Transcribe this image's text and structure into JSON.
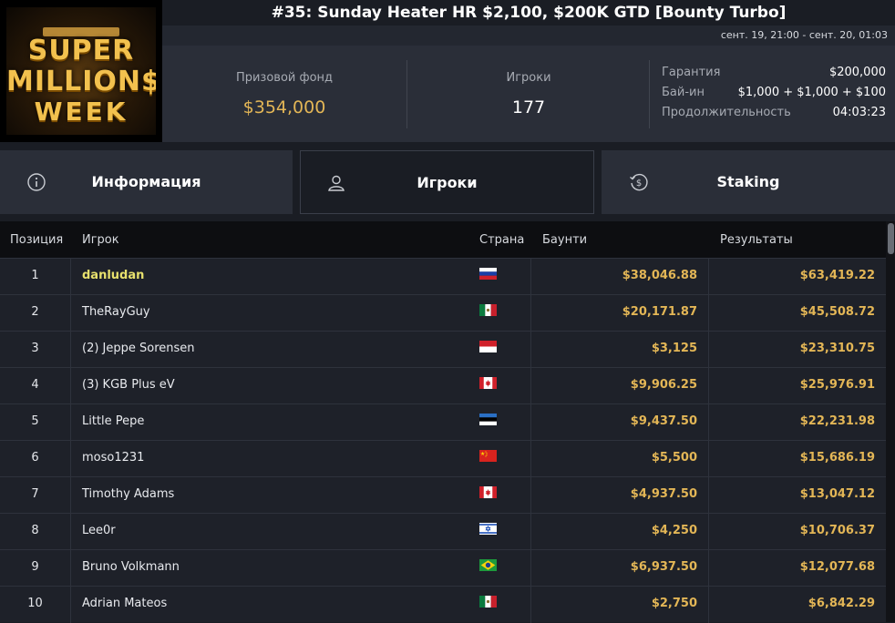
{
  "logo": {
    "line1": "SUPER",
    "line2": "MILLION$",
    "line3": "WEEK"
  },
  "header": {
    "title": "#35: Sunday Heater HR $2,100, $200K GTD [Bounty Turbo]",
    "dates": "сент. 19, 21:00 - сент. 20, 01:03"
  },
  "stats": {
    "prize_label": "Призовой фонд",
    "prize_value": "$354,000",
    "players_label": "Игроки",
    "players_value": "177",
    "details": [
      {
        "label": "Гарантия",
        "value": "$200,000"
      },
      {
        "label": "Бай-ин",
        "value": "$1,000 + $1,000 + $100"
      },
      {
        "label": "Продолжительность",
        "value": "04:03:23"
      }
    ]
  },
  "tabs": [
    {
      "label": "Информация",
      "icon": "info-icon"
    },
    {
      "label": "Игроки",
      "icon": "user-icon"
    },
    {
      "label": "Staking",
      "icon": "dollar-cycle-icon"
    }
  ],
  "table": {
    "headers": {
      "position": "Позиция",
      "player": "Игрок",
      "country": "Страна",
      "bounty": "Баунти",
      "results": "Результаты"
    },
    "rows": [
      {
        "pos": "1",
        "player": "danludan",
        "flag": "russia",
        "bounty": "$38,046.88",
        "result": "$63,419.22"
      },
      {
        "pos": "2",
        "player": "TheRayGuy",
        "flag": "mexico",
        "bounty": "$20,171.87",
        "result": "$45,508.72"
      },
      {
        "pos": "3",
        "player": "(2) Jeppe Sorensen",
        "flag": "indonesia",
        "bounty": "$3,125",
        "result": "$23,310.75"
      },
      {
        "pos": "4",
        "player": "(3) KGB Plus eV",
        "flag": "canada",
        "bounty": "$9,906.25",
        "result": "$25,976.91"
      },
      {
        "pos": "5",
        "player": "Little Pepe",
        "flag": "estonia",
        "bounty": "$9,437.50",
        "result": "$22,231.98"
      },
      {
        "pos": "6",
        "player": "moso1231",
        "flag": "china",
        "bounty": "$5,500",
        "result": "$15,686.19"
      },
      {
        "pos": "7",
        "player": "Timothy Adams",
        "flag": "canada",
        "bounty": "$4,937.50",
        "result": "$13,047.12"
      },
      {
        "pos": "8",
        "player": "Lee0r",
        "flag": "israel",
        "bounty": "$4,250",
        "result": "$10,706.37"
      },
      {
        "pos": "9",
        "player": "Bruno Volkmann",
        "flag": "brazil",
        "bounty": "$6,937.50",
        "result": "$12,077.68"
      },
      {
        "pos": "10",
        "player": "Adrian Mateos",
        "flag": "mexico",
        "bounty": "$2,750",
        "result": "$6,842.29"
      }
    ]
  }
}
